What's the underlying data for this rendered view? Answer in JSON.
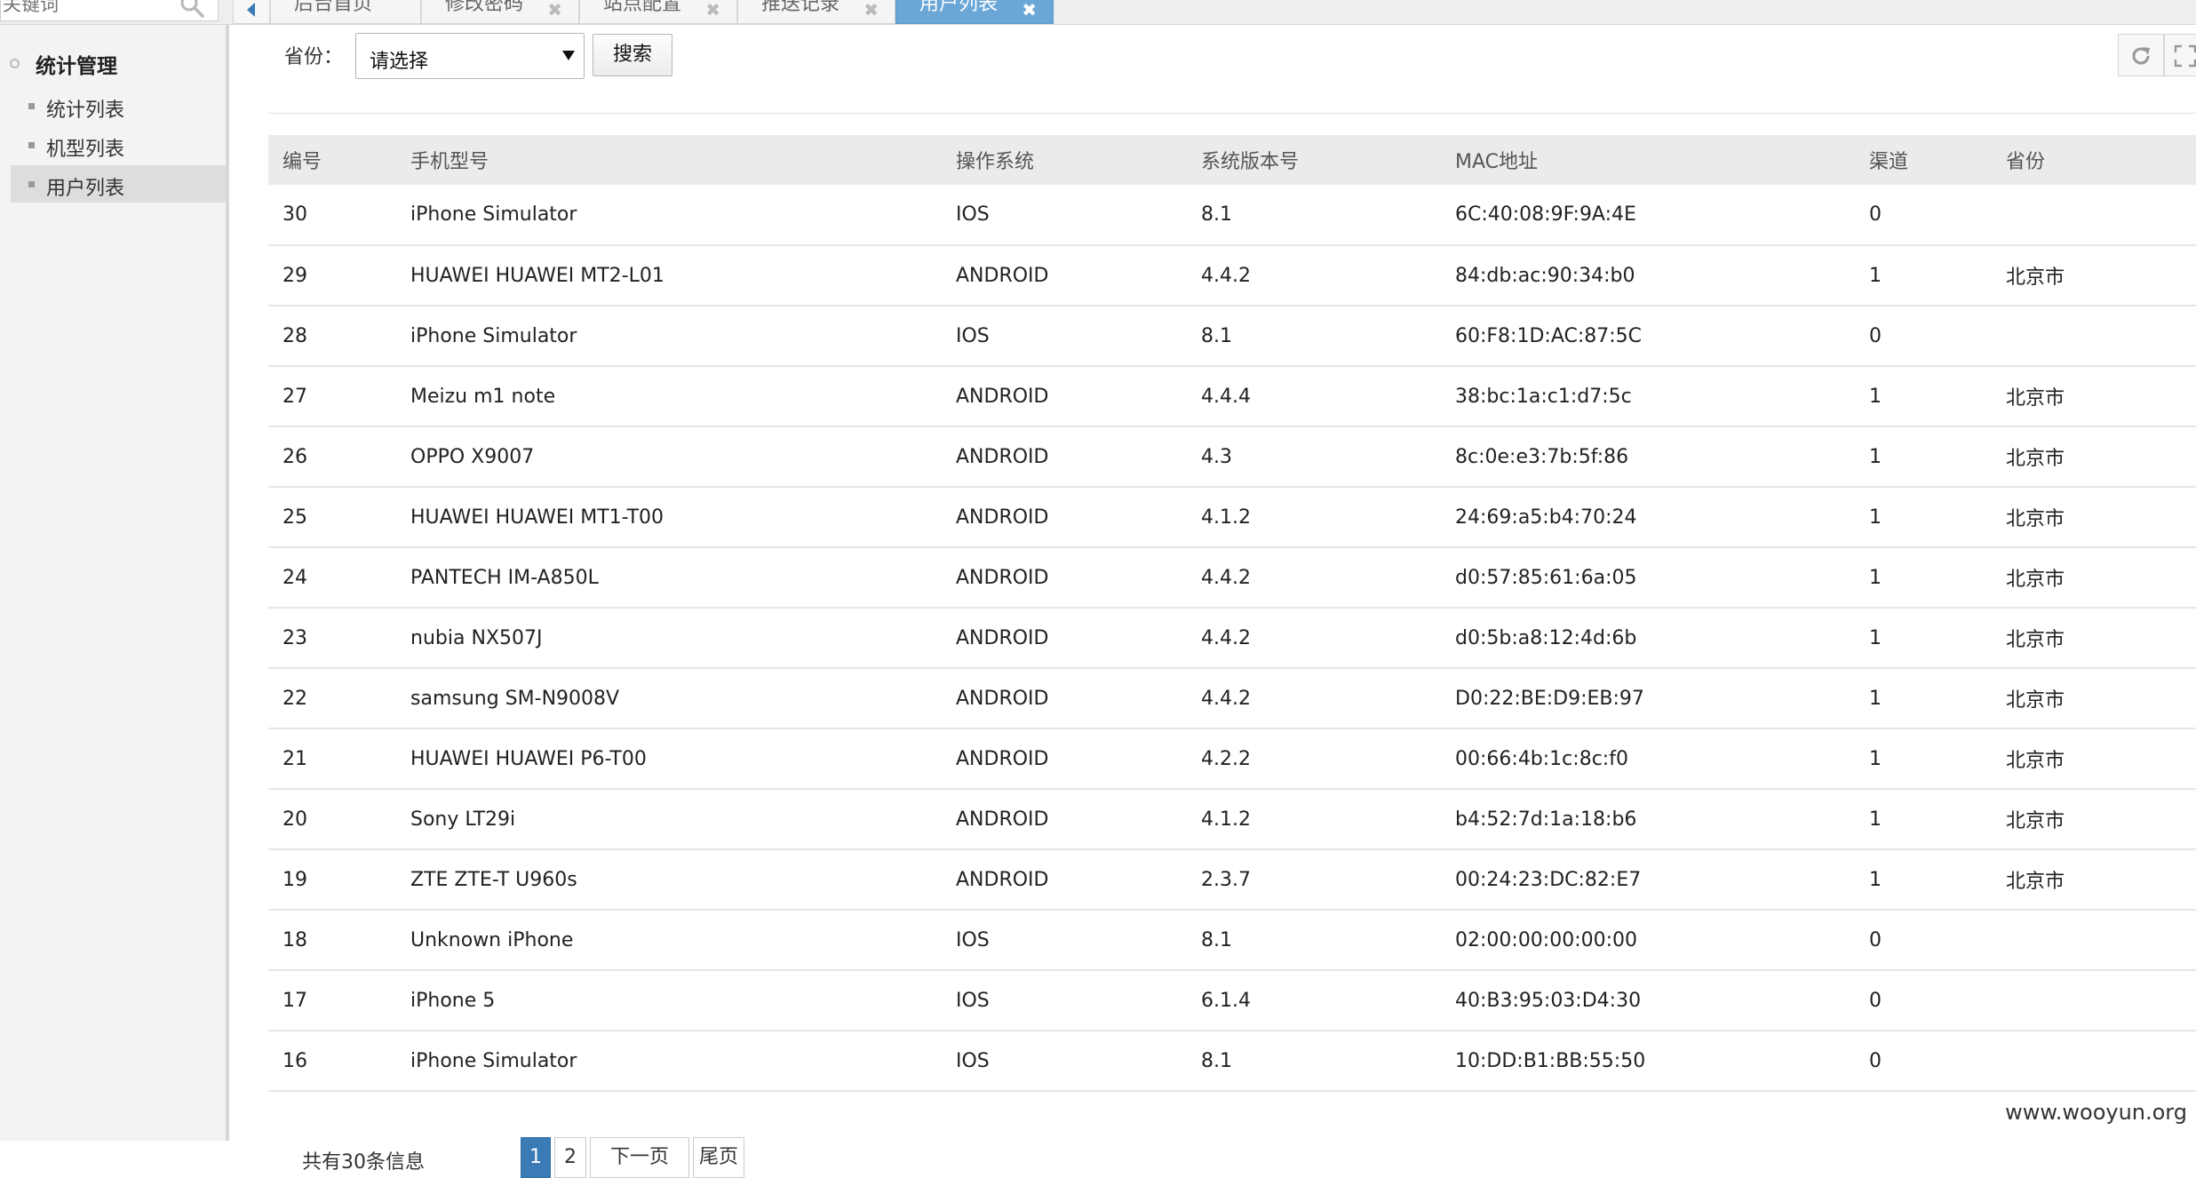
{
  "topbar": {
    "search_placeholder": "关键词",
    "tabs": [
      {
        "label": "后台首页",
        "closable": false
      },
      {
        "label": "修改密码",
        "closable": true
      },
      {
        "label": "站点配置",
        "closable": true
      },
      {
        "label": "推送记录",
        "closable": true
      },
      {
        "label": "用户列表",
        "closable": true,
        "active": true
      }
    ],
    "close_glyph": "✖"
  },
  "sidebar": {
    "group_label": "统计管理",
    "items": [
      {
        "label": "统计列表"
      },
      {
        "label": "机型列表"
      },
      {
        "label": "用户列表",
        "active": true
      }
    ]
  },
  "filter": {
    "label": "省份：",
    "select_value": "请选择",
    "search_label": "搜索"
  },
  "table": {
    "headers": [
      "编号",
      "手机型号",
      "操作系统",
      "系统版本号",
      "MAC地址",
      "渠道",
      "省份"
    ],
    "rows": [
      [
        "30",
        "iPhone Simulator",
        "IOS",
        "8.1",
        "6C:40:08:9F:9A:4E",
        "0",
        ""
      ],
      [
        "29",
        "HUAWEI HUAWEI MT2-L01",
        "ANDROID",
        "4.4.2",
        "84:db:ac:90:34:b0",
        "1",
        "北京市"
      ],
      [
        "28",
        "iPhone Simulator",
        "IOS",
        "8.1",
        "60:F8:1D:AC:87:5C",
        "0",
        ""
      ],
      [
        "27",
        "Meizu m1 note",
        "ANDROID",
        "4.4.4",
        "38:bc:1a:c1:d7:5c",
        "1",
        "北京市"
      ],
      [
        "26",
        "OPPO X9007",
        "ANDROID",
        "4.3",
        "8c:0e:e3:7b:5f:86",
        "1",
        "北京市"
      ],
      [
        "25",
        "HUAWEI HUAWEI MT1-T00",
        "ANDROID",
        "4.1.2",
        "24:69:a5:b4:70:24",
        "1",
        "北京市"
      ],
      [
        "24",
        "PANTECH IM-A850L",
        "ANDROID",
        "4.4.2",
        "d0:57:85:61:6a:05",
        "1",
        "北京市"
      ],
      [
        "23",
        "nubia NX507J",
        "ANDROID",
        "4.4.2",
        "d0:5b:a8:12:4d:6b",
        "1",
        "北京市"
      ],
      [
        "22",
        "samsung SM-N9008V",
        "ANDROID",
        "4.4.2",
        "D0:22:BE:D9:EB:97",
        "1",
        "北京市"
      ],
      [
        "21",
        "HUAWEI HUAWEI P6-T00",
        "ANDROID",
        "4.2.2",
        "00:66:4b:1c:8c:f0",
        "1",
        "北京市"
      ],
      [
        "20",
        "Sony LT29i",
        "ANDROID",
        "4.1.2",
        "b4:52:7d:1a:18:b6",
        "1",
        "北京市"
      ],
      [
        "19",
        "ZTE ZTE-T U960s",
        "ANDROID",
        "2.3.7",
        "00:24:23:DC:82:E7",
        "1",
        "北京市"
      ],
      [
        "18",
        "Unknown iPhone",
        "IOS",
        "8.1",
        "02:00:00:00:00:00",
        "0",
        ""
      ],
      [
        "17",
        "iPhone 5",
        "IOS",
        "6.1.4",
        "40:B3:95:03:D4:30",
        "0",
        ""
      ],
      [
        "16",
        "iPhone Simulator",
        "IOS",
        "8.1",
        "10:DD:B1:BB:55:50",
        "0",
        ""
      ]
    ]
  },
  "pager": {
    "total_text": "共有30条信息",
    "pages": [
      "1",
      "2"
    ],
    "current_page": "1",
    "next_label": "下一页",
    "last_label": "尾页"
  },
  "watermark": "www.wooyun.org",
  "colors": {
    "active_tab": "#6aa6d6",
    "active_page": "#3a7bb5",
    "sidebar_bg": "#f3f3f3",
    "header_bg": "#ebebeb"
  }
}
